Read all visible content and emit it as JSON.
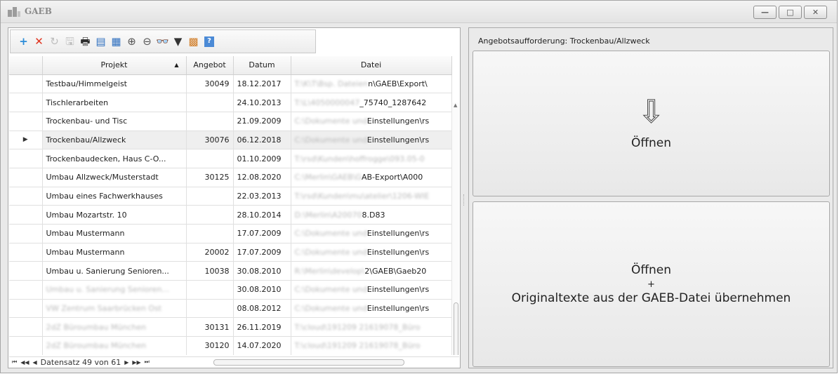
{
  "window": {
    "title": "GAEB",
    "min_label": "—",
    "max_label": "□",
    "close_label": "✕"
  },
  "toolbar": {
    "icons": [
      {
        "name": "add-icon",
        "glyph": "+",
        "color": "#2a8cd8"
      },
      {
        "name": "delete-icon",
        "glyph": "✕",
        "color": "#e0331e"
      },
      {
        "name": "undo-icon",
        "glyph": "↻",
        "color": "#bdbdbd"
      },
      {
        "name": "save-icon",
        "glyph": "🖫",
        "color": "#bdbdbd"
      },
      {
        "name": "print-icon",
        "glyph": "🖶",
        "color": "#2d2d2d"
      },
      {
        "name": "print-preview-icon",
        "glyph": "▤",
        "color": "#2e6fbf"
      },
      {
        "name": "columns-icon",
        "glyph": "▦",
        "color": "#2e6fbf"
      },
      {
        "name": "zoom-in-icon",
        "glyph": "⊕",
        "color": "#555"
      },
      {
        "name": "zoom-out-icon",
        "glyph": "⊖",
        "color": "#555"
      },
      {
        "name": "find-icon",
        "glyph": "👓",
        "color": "#333"
      },
      {
        "name": "filter-icon",
        "glyph": "▼",
        "color": "#333"
      },
      {
        "name": "grid-settings-icon",
        "glyph": "▩",
        "color": "#d07a22"
      },
      {
        "name": "help-icon",
        "glyph": "?",
        "color": "#2e6fbf"
      }
    ]
  },
  "grid": {
    "columns": [
      "Projekt",
      "Angebot",
      "Datum",
      "Datei"
    ],
    "rows": [
      {
        "projekt": "Testbau/Himmelgeist",
        "angebot": "30049",
        "datum": "18.12.2017",
        "datei_blur": "T:\\K\\T\\Bsp. Dateien",
        "datei": "n\\GAEB\\Export\\"
      },
      {
        "projekt": "Tischlerarbeiten",
        "angebot": "",
        "datum": "24.10.2013",
        "datei_blur": "T:\\L\\4050000047",
        "datei": "_75740_1287642"
      },
      {
        "projekt": "Trockenbau- und Tisc",
        "angebot": "",
        "datum": "21.09.2009",
        "datei_blur": "C:\\Dokumente und",
        "datei": "Einstellungen\\rs"
      },
      {
        "projekt": "Trockenbau/Allzweck",
        "angebot": "30076",
        "datum": "06.12.2018",
        "datei_blur": "C:\\Dokumente und",
        "datei": "Einstellungen\\rs"
      },
      {
        "projekt": "Trockenbaudecken, Haus C-O...",
        "angebot": "",
        "datum": "01.10.2009",
        "datei_blur": "T:\\rsd\\Kunden\\hoffrogge\\093.05-0",
        "datei": ""
      },
      {
        "projekt": "Umbau Allzweck/Musterstadt",
        "angebot": "30125",
        "datum": "12.08.2020",
        "datei_blur": "C:\\Merlin\\GAEB\\G",
        "datei": "AB-Export\\A000"
      },
      {
        "projekt": "Umbau eines Fachwerkhauses",
        "angebot": "",
        "datum": "22.03.2013",
        "datei_blur": "T:\\rsd\\Kunden\\mu\\atelier\\1206-WIE",
        "datei": ""
      },
      {
        "projekt": "Umbau Mozartstr. 10",
        "angebot": "",
        "datum": "28.10.2014",
        "datei_blur": "D:\\Merlin\\A20070",
        "datei": "8.D83"
      },
      {
        "projekt": "Umbau Mustermann",
        "angebot": "",
        "datum": "17.07.2009",
        "datei_blur": "C:\\Dokumente und",
        "datei": "Einstellungen\\rs"
      },
      {
        "projekt": "Umbau Mustermann",
        "angebot": "20002",
        "datum": "17.07.2009",
        "datei_blur": "C:\\Dokumente und",
        "datei": "Einstellungen\\rs"
      },
      {
        "projekt": "Umbau u. Sanierung Senioren...",
        "angebot": "10038",
        "datum": "30.08.2010",
        "datei_blur": "R:\\Merlin\\develop\\",
        "datei": "2\\GAEB\\Gaeb20"
      },
      {
        "projekt_blur": "Umbau u. Sanierung Senioren...",
        "projekt": "",
        "angebot": "",
        "datum": "30.08.2010",
        "datei_blur": "C:\\Dokumente und",
        "datei": "Einstellungen\\rs"
      },
      {
        "projekt_blur": "VW Zentrum Saarbrücken Ost",
        "projekt": "",
        "angebot": "",
        "datum": "08.08.2012",
        "datei_blur": "C:\\Dokumente und",
        "datei": "Einstellungen\\rs"
      },
      {
        "projekt_blur": "2dZ Büroumbau München",
        "projekt": "",
        "angebot": "30131",
        "datum": "26.11.2019",
        "datei_blur": "T:\\cloud\\191209 21619078_Büro",
        "datei": ""
      },
      {
        "projekt_blur": "2dZ Büroumbau München",
        "projekt": "",
        "angebot": "30120",
        "datum": "14.07.2020",
        "datei_blur": "T:\\cloud\\191209 21619078_Büro",
        "datei": ""
      }
    ],
    "current_row_index": 3
  },
  "navigator": {
    "first": "⏮",
    "prev_page": "◀◀",
    "prev": "◀",
    "record_text": "Datensatz 49 von 61",
    "next": "▶",
    "next_page": "▶▶",
    "last": "⏭"
  },
  "right_panel": {
    "heading": "Angebotsaufforderung: Trockenbau/Allzweck",
    "open_button": {
      "arrow": "⇩",
      "label": "Öffnen"
    },
    "open_with_texts_button": {
      "line1": "Öffnen",
      "plus": "+",
      "line2": "Originaltexte aus der GAEB-Datei übernehmen"
    }
  }
}
